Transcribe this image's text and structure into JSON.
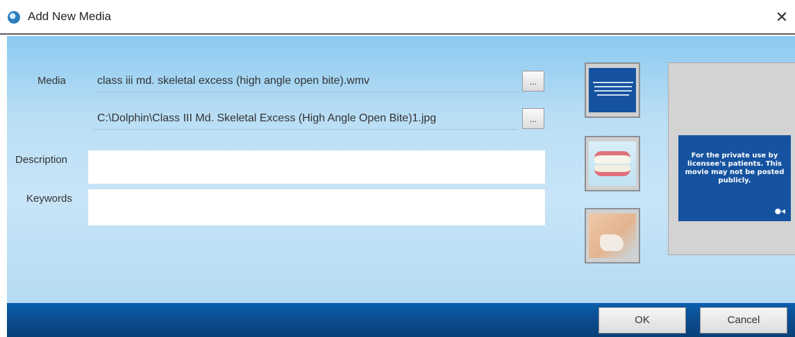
{
  "window": {
    "title": "Add New Media",
    "close_glyph": "✕",
    "icon": "app-logo-icon"
  },
  "form": {
    "media_label": "Media",
    "media_file": "class iii md. skeletal excess (high angle open bite).wmv",
    "thumbnail_file": "C:\\Dolphin\\Class III Md. Skeletal Excess (High Angle Open Bite)1.jpg",
    "browse_label": "...",
    "description_label": "Description",
    "description_value": "",
    "keywords_label": "Keywords",
    "keywords_value": ""
  },
  "preview": {
    "text": "For the private use by licensee's patients. This movie may not be posted publicly."
  },
  "buttons": {
    "ok": "OK",
    "cancel": "Cancel"
  },
  "colors": {
    "accent": "#1553a0",
    "footer": "#0b4f93",
    "body_bg": "#b9def5"
  }
}
